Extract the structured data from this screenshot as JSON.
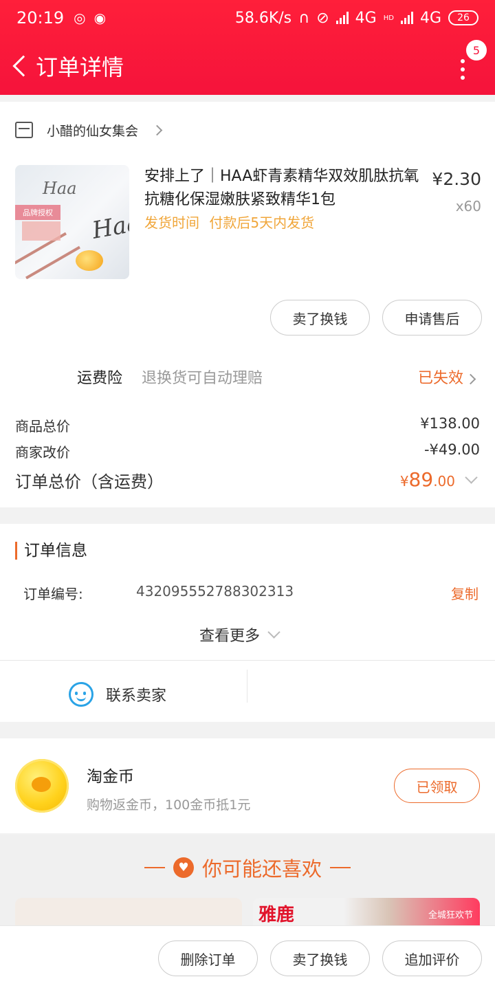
{
  "status_bar": {
    "time": "20:19",
    "network_speed": "58.6K/s",
    "net1": "4G",
    "net2_hd": "HD",
    "net2": "4G",
    "battery": "26"
  },
  "header": {
    "title": "订单详情",
    "more_badge": "5"
  },
  "order": {
    "shop_name": "小醋的仙女集会",
    "product": {
      "title": "安排上了｜HAA虾青素精华双效肌肽抗氧抗糖化保湿嫩肤紧致精华1包",
      "shipping_label": "发货时间",
      "shipping_value": "付款后5天内发货",
      "price": "¥2.30",
      "quantity": "x60",
      "image": {
        "brand_text_1": "Haa",
        "brand_text_2": "Haa",
        "tag": "品牌授权"
      }
    },
    "actions": {
      "sell_label": "卖了换钱",
      "after_sale_label": "申请售后"
    },
    "insurance": {
      "label": "运费险",
      "desc": "退换货可自动理赔",
      "status": "已失效"
    },
    "summary": {
      "goods_total_label": "商品总价",
      "goods_total_value": "¥138.00",
      "adjust_label": "商家改价",
      "adjust_value": "-¥49.00",
      "order_total_label": "订单总价（含运费）",
      "order_total_currency": "¥",
      "order_total_int": "89",
      "order_total_dec": ".00"
    }
  },
  "order_info": {
    "title": "订单信息",
    "number_label": "订单编号:",
    "number_value": "432095552788302313",
    "copy_label": "复制",
    "see_more_label": "查看更多",
    "contact_label": "联系卖家"
  },
  "coins": {
    "title": "淘金币",
    "desc": "购物返金币，100金币抵1元",
    "button_label": "已领取"
  },
  "recommend": {
    "title": "你可能还喜欢",
    "heart_icon": "heart-icon",
    "tile2_brand": "雅鹿",
    "tile2_promo": "全城狂欢节"
  },
  "bottom_bar": {
    "delete_label": "删除订单",
    "sell_label": "卖了换钱",
    "review_label": "追加评价"
  },
  "colors": {
    "header_red": "#f5133b",
    "accent_orange": "#ec6a2b",
    "shipping_orange": "#f0a63a",
    "contact_blue": "#2aa3e6"
  }
}
